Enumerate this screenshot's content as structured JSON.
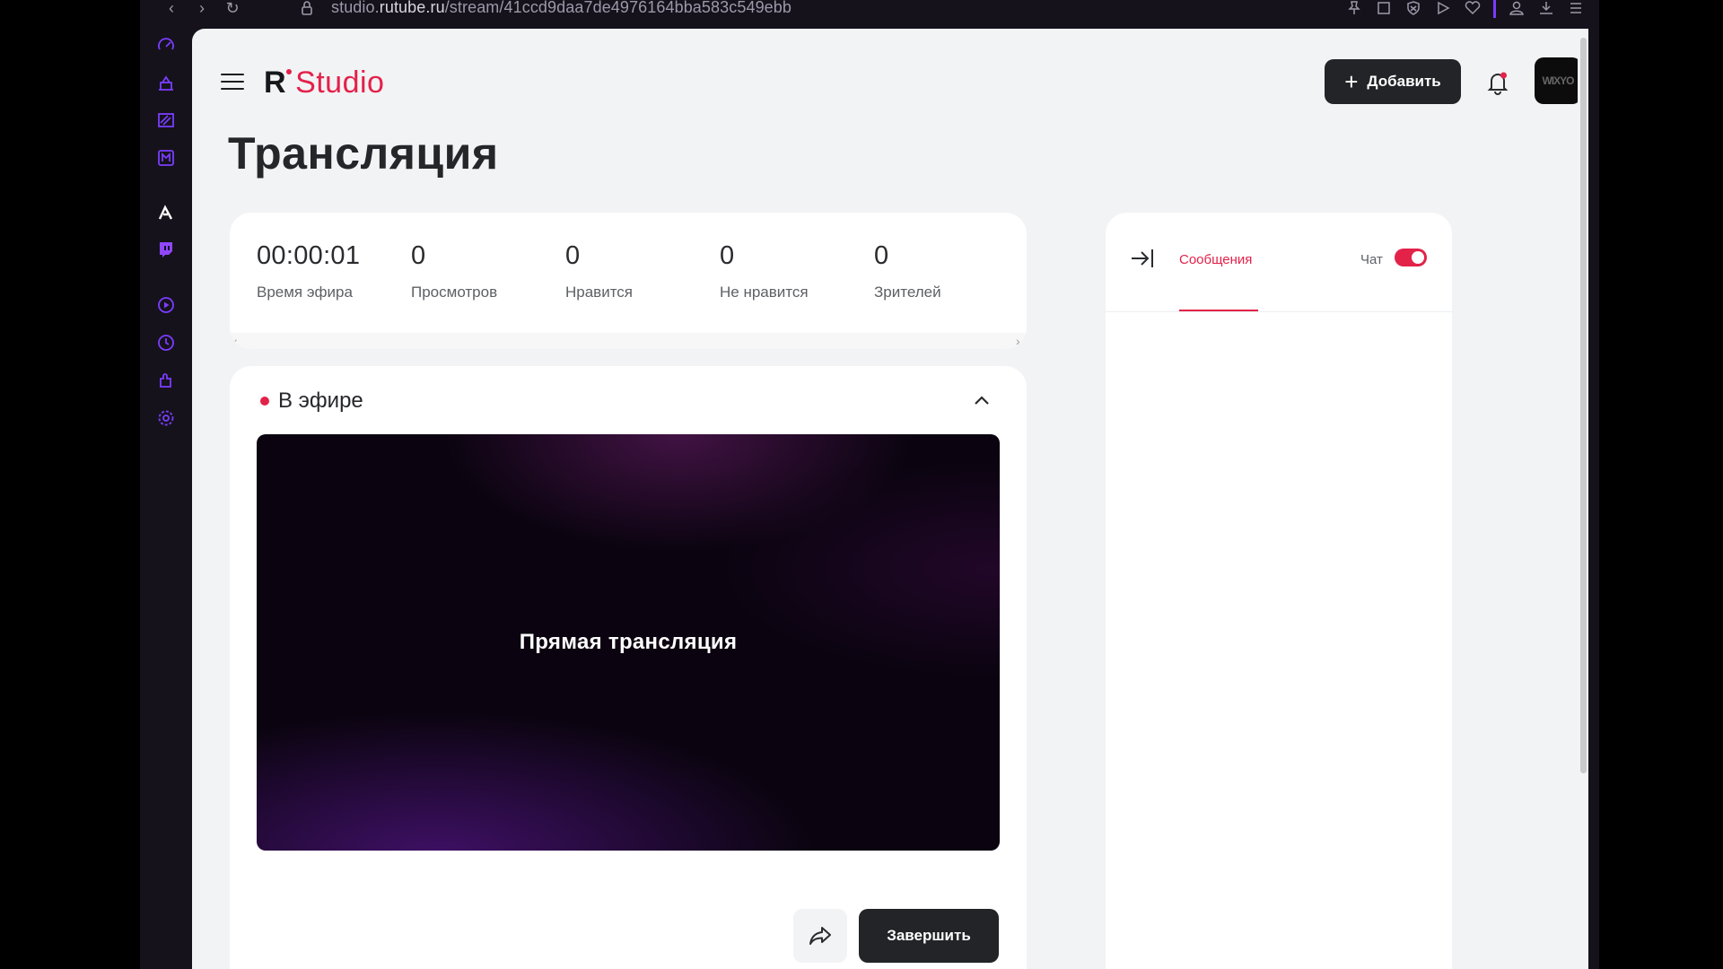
{
  "browser": {
    "url_prefix": "studio.",
    "url_domain": "rutube.ru",
    "url_path": "/stream/41ccd9daa7de4976164bba583c549ebb",
    "nav": {
      "back": "‹",
      "forward": "›",
      "reload": "↻"
    }
  },
  "app": {
    "logo_r": "R",
    "logo_studio": "Studio",
    "add_button_label": "Добавить",
    "add_button_icon": "+",
    "avatar_text": "WIXYO"
  },
  "page": {
    "title": "Трансляция"
  },
  "stats": [
    {
      "value": "00:00:01",
      "label": "Время эфира"
    },
    {
      "value": "0",
      "label": "Просмотров"
    },
    {
      "value": "0",
      "label": "Нравится"
    },
    {
      "value": "0",
      "label": "Не нравится"
    },
    {
      "value": "0",
      "label": "Зрителей"
    }
  ],
  "stats_scroll": {
    "left": "‹",
    "right": "›"
  },
  "live": {
    "status": "В эфире",
    "player_label": "Прямая трансляция",
    "finish_label": "Завершить"
  },
  "chat": {
    "tab_messages": "Сообщения",
    "chat_label": "Чат",
    "chat_enabled": true
  },
  "colors": {
    "accent": "#e3224a",
    "dark_button": "#222427",
    "sidebar_icon": "#7b3dff"
  }
}
